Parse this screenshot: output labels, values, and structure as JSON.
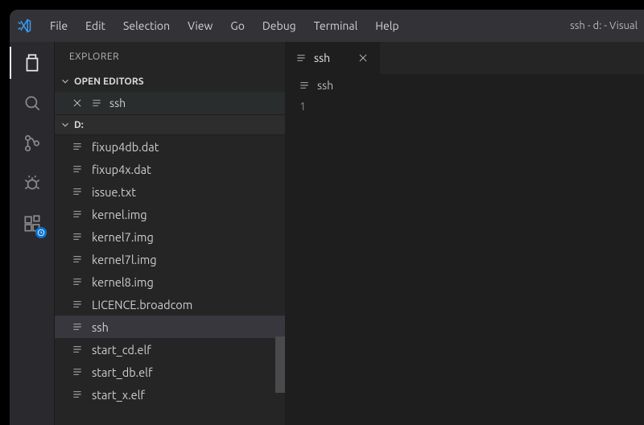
{
  "menubar": {
    "items": [
      {
        "label": "File"
      },
      {
        "label": "Edit"
      },
      {
        "label": "Selection"
      },
      {
        "label": "View"
      },
      {
        "label": "Go"
      },
      {
        "label": "Debug"
      },
      {
        "label": "Terminal"
      },
      {
        "label": "Help"
      }
    ],
    "windowTitle": "ssh - d: - Visual"
  },
  "explorer": {
    "title": "EXPLORER",
    "openEditorsLabel": "OPEN EDITORS",
    "openEditors": [
      {
        "name": "ssh"
      }
    ],
    "workspaceLabel": "D:",
    "files": [
      {
        "name": "fixup4db.dat"
      },
      {
        "name": "fixup4x.dat"
      },
      {
        "name": "issue.txt"
      },
      {
        "name": "kernel.img"
      },
      {
        "name": "kernel7.img"
      },
      {
        "name": "kernel7l.img"
      },
      {
        "name": "kernel8.img"
      },
      {
        "name": "LICENCE.broadcom"
      },
      {
        "name": "ssh",
        "selected": true
      },
      {
        "name": "start_cd.elf"
      },
      {
        "name": "start_db.elf"
      },
      {
        "name": "start_x.elf"
      }
    ]
  },
  "editor": {
    "tabs": [
      {
        "name": "ssh"
      }
    ],
    "breadcrumb": "ssh",
    "lineNumber": "1",
    "content": ""
  }
}
